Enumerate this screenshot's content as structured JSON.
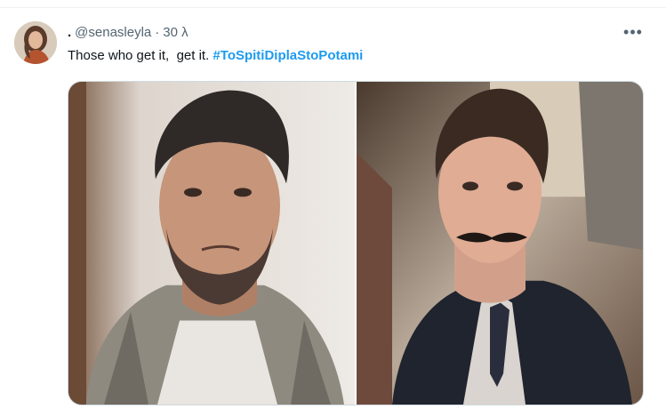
{
  "tweet": {
    "display_name": ".",
    "handle": "@senasleyla",
    "separator": "·",
    "time": "30 λ",
    "text_plain": "Those who get it,  get it. ",
    "hashtag": "#ToSpitiDiplaStoPotami",
    "more_icon": "more-horizontal-icon"
  },
  "media": {
    "images": [
      {
        "name": "photo-1"
      },
      {
        "name": "photo-2"
      }
    ]
  },
  "colors": {
    "hashtag": "#1d9bf0",
    "secondary_text": "#536471",
    "border": "#cfd9de"
  }
}
